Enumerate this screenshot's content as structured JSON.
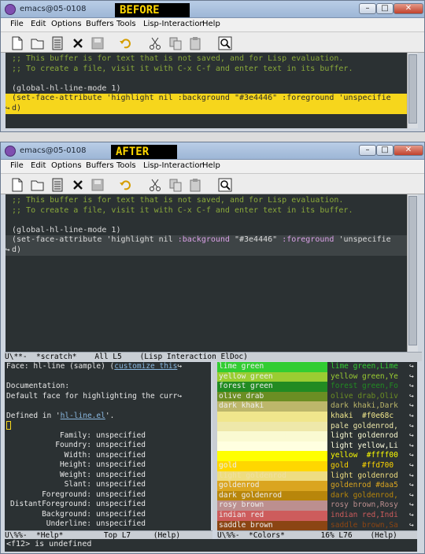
{
  "colors": {
    "editor_bg": "#2b3133",
    "comment": "#8aa93a",
    "highlight_bg": "#f6d61c",
    "keyword": "#d9a0e6",
    "link": "#8ab8e0"
  },
  "before": {
    "title": "emacs@05-0108",
    "label": "BEFORE",
    "menu": [
      "File",
      "Edit",
      "Options",
      "Buffers",
      "Tools",
      "Lisp-Interaction",
      "Help"
    ],
    "lines": {
      "c1": ";; This buffer is for text that is not saved, and for Lisp evaluation.",
      "c2": ";; To create a file, visit it with C-x C-f and enter text in its buffer.",
      "l4": "(global-hl-line-mode 1)",
      "l5": "(set-face-attribute 'highlight nil :background \"#3e4446\" :foreground 'unspecifie",
      "l6": "d)"
    }
  },
  "after": {
    "title": "emacs@05-0108",
    "label": "AFTER",
    "menu": [
      "File",
      "Edit",
      "Options",
      "Buffers",
      "Tools",
      "Lisp-Interaction",
      "Help"
    ],
    "lines": {
      "c1": ";; This buffer is for text that is not saved, and for Lisp evaluation.",
      "c2": ";; To create a file, visit it with C-x C-f and enter text in its buffer.",
      "l4": "(global-hl-line-mode 1)",
      "l5a": "(set-face-attribute 'highlight nil ",
      "l5b": ":background",
      "l5c": " \"#3e4446\" ",
      "l5d": ":foreground",
      "l5e": " 'unspecifie",
      "l6": "d)"
    },
    "modeline_top": "U\\**-  *scratch*    All L5    (Lisp Interaction ElDoc)",
    "help": {
      "face_prefix": "Face: hl-line (sample) (",
      "customize_link": "customize this",
      "doc_heading": "Documentation:",
      "doc_text": "Default face for highlighting the curr",
      "defined_prefix": "Defined in '",
      "defined_link": "hl-line.el",
      "defined_suffix": "'.",
      "attributes": [
        {
          "name": "Family:",
          "value": "unspecified"
        },
        {
          "name": "Foundry:",
          "value": "unspecified"
        },
        {
          "name": "Width:",
          "value": "unspecified"
        },
        {
          "name": "Height:",
          "value": "unspecified"
        },
        {
          "name": "Weight:",
          "value": "unspecified"
        },
        {
          "name": "Slant:",
          "value": "unspecified"
        },
        {
          "name": "Foreground:",
          "value": "unspecified"
        },
        {
          "name": "DistantForeground:",
          "value": "unspecified"
        },
        {
          "name": "Background:",
          "value": "unspecified"
        },
        {
          "name": "Underline:",
          "value": "unspecified"
        }
      ]
    },
    "colors_list": [
      {
        "swatch": "lime green",
        "color": "#32cd32",
        "text": "#eeeeee",
        "name": "lime green,Lime",
        "name_color": "#32cd32"
      },
      {
        "swatch": "yellow green",
        "color": "#9acd32",
        "text": "#eeeeee",
        "name": "yellow green,Ye",
        "name_color": "#9acd32"
      },
      {
        "swatch": "forest green",
        "color": "#228b22",
        "text": "#eeeeee",
        "name": "forest green,Fo",
        "name_color": "#228b22"
      },
      {
        "swatch": "olive drab",
        "color": "#6b8e23",
        "text": "#eeeeee",
        "name": "olive drab,Oliv",
        "name_color": "#6b8e23"
      },
      {
        "swatch": "dark khaki",
        "color": "#bdb76b",
        "text": "#eeeeee",
        "name": "dark khaki,Dark",
        "name_color": "#bdb76b"
      },
      {
        "swatch": "khaki",
        "color": "#f0e68c",
        "text": "#f0e68c",
        "name": "khaki  #f0e68c",
        "name_color": "#f0e68c"
      },
      {
        "swatch": "pale goldenrod",
        "color": "#eee8aa",
        "text": "#eee8aa",
        "name": "pale goldenrod,",
        "name_color": "#eee8aa"
      },
      {
        "swatch": "light goldenrod",
        "color": "#fafad2",
        "text": "#fafad2",
        "name": "light goldenrod",
        "name_color": "#fafad2"
      },
      {
        "swatch": "light yellow",
        "color": "#ffffe0",
        "text": "#ffffe0",
        "name": "light yellow,Li",
        "name_color": "#ffffe0"
      },
      {
        "swatch": "yellow",
        "color": "#ffff00",
        "text": "#ffff00",
        "name": "yellow  #ffff00",
        "name_color": "#ffff00"
      },
      {
        "swatch": "gold",
        "color": "#ffd700",
        "text": "#eeeeee",
        "name": "gold   #ffd700",
        "name_color": "#ffd700"
      },
      {
        "swatch": "light goldenrod",
        "color": "#eedd82",
        "text": "#f0e0a0",
        "name": "light goldenrod",
        "name_color": "#eedd82"
      },
      {
        "swatch": "goldenrod",
        "color": "#daa520",
        "text": "#eeeeee",
        "name": "goldenrod #daa5",
        "name_color": "#daa520"
      },
      {
        "swatch": "dark goldenrod",
        "color": "#b8860b",
        "text": "#eeeeee",
        "name": "dark goldenrod,",
        "name_color": "#b8860b"
      },
      {
        "swatch": "rosy brown",
        "color": "#bc8f8f",
        "text": "#eeeeee",
        "name": "rosy brown,Rosy",
        "name_color": "#bc8f8f"
      },
      {
        "swatch": "indian red",
        "color": "#cd5c5c",
        "text": "#eeeeee",
        "name": "indian red,Indi",
        "name_color": "#cd5c5c"
      },
      {
        "swatch": "saddle brown",
        "color": "#8b4513",
        "text": "#eeeeee",
        "name": "saddle brown,Sa",
        "name_color": "#8b4513"
      }
    ],
    "modeline_left": "U\\%%-  *Help*         Top L7     (Help)",
    "modeline_right": "U\\%%-  *Colors*        16% L76    (Help)",
    "minibuffer": "<f12> is undefined"
  }
}
